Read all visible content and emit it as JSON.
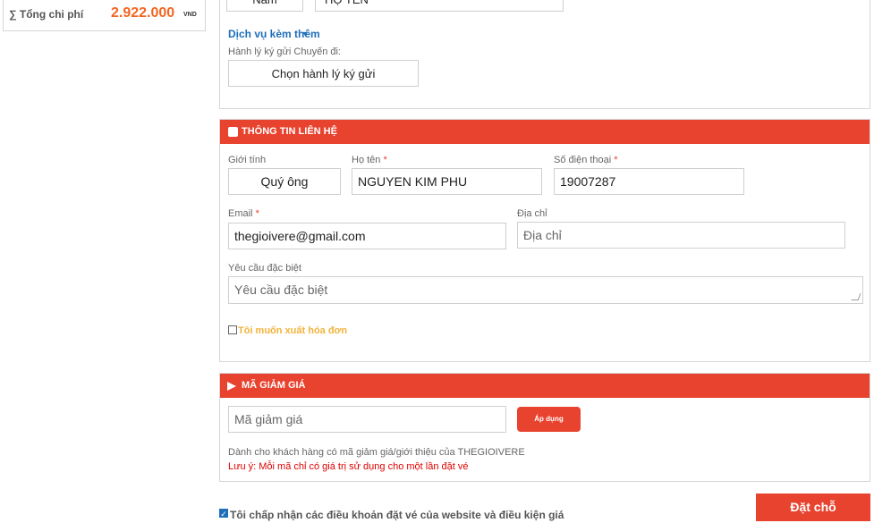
{
  "summary": {
    "total_label": "∑ Tổng chi phí",
    "total_value": "2.922.000",
    "total_currency": "VND"
  },
  "passenger": {
    "gender_value": "Nam",
    "name_value": "HỌ TÊN",
    "extra_services_label": "Dịch vụ kèm thêm",
    "baggage_label": "Hành lý ký gửi Chuyến đi:",
    "baggage_button": "Chọn hành lý ký gửi"
  },
  "contact": {
    "title": "THÔNG TIN LIÊN HỆ",
    "gender_label": "Giới tính",
    "gender_value": "Quý ông",
    "name_label": "Họ tên",
    "name_value": "NGUYEN KIM PHU",
    "phone_label": "Số điện thoại",
    "phone_value": "19007287",
    "email_label": "Email",
    "email_value": "thegioivere@gmail.com",
    "address_label": "Địa chỉ",
    "address_placeholder": "Địa chỉ",
    "special_label": "Yêu cầu đặc biệt",
    "special_placeholder": "Yêu cầu đặc biệt",
    "invoice_label": "Tôi muốn xuất hóa đơn",
    "required_mark": "*"
  },
  "discount": {
    "title": "MÃ GIẢM GIÁ",
    "code_placeholder": "Mã giảm giá",
    "apply_button": "Áp dụng",
    "hint": "Dành cho khách hàng có mã giảm giá/giới thiệu của THEGIOIVERE",
    "note": "Lưu ý: Mỗi mã chỉ có giá trị sử dụng cho một lần đặt vé"
  },
  "footer": {
    "accept_label": "Tôi chấp nhận các điều khoản đặt vé của website và điều kiện giá",
    "submit_button": "Đặt chỗ"
  },
  "colors": {
    "accent_red": "#e8432f",
    "price_orange": "#f26522",
    "link_blue": "#1e6fb8",
    "invoice_yellow": "#f2b33d"
  }
}
